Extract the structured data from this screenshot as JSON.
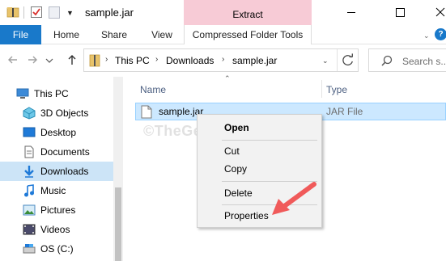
{
  "window": {
    "title": "sample.jar",
    "context_tab_group": "Extract"
  },
  "ribbon": {
    "tabs": {
      "file": "File",
      "home": "Home",
      "share": "Share",
      "view": "View",
      "compressed_folder_tools": "Compressed Folder Tools"
    },
    "help_glyph": "?"
  },
  "address_bar": {
    "breadcrumbs": [
      "This PC",
      "Downloads",
      "sample.jar"
    ],
    "search_placeholder": "Search s..."
  },
  "navigation_pane": {
    "items": [
      {
        "label": "This PC",
        "icon": "this-pc-icon"
      },
      {
        "label": "3D Objects",
        "icon": "3d-objects-icon"
      },
      {
        "label": "Desktop",
        "icon": "desktop-icon"
      },
      {
        "label": "Documents",
        "icon": "documents-icon"
      },
      {
        "label": "Downloads",
        "icon": "downloads-icon",
        "selected": true
      },
      {
        "label": "Music",
        "icon": "music-icon"
      },
      {
        "label": "Pictures",
        "icon": "pictures-icon"
      },
      {
        "label": "Videos",
        "icon": "videos-icon"
      },
      {
        "label": "OS (C:)",
        "icon": "drive-icon"
      }
    ]
  },
  "file_list": {
    "columns": {
      "name": "Name",
      "type": "Type"
    },
    "files": [
      {
        "name": "sample.jar",
        "type": "JAR File",
        "selected": true
      }
    ],
    "watermark": "©TheGeekPage.com"
  },
  "context_menu": {
    "items": [
      "Open",
      "Cut",
      "Copy",
      "Delete",
      "Properties"
    ]
  },
  "colors": {
    "accent": "#1979ca",
    "extract_tab": "#f7cbd6",
    "selection": "#cce8ff",
    "nav_selection": "#cce4f7",
    "annotation_arrow": "#f05a5a"
  }
}
